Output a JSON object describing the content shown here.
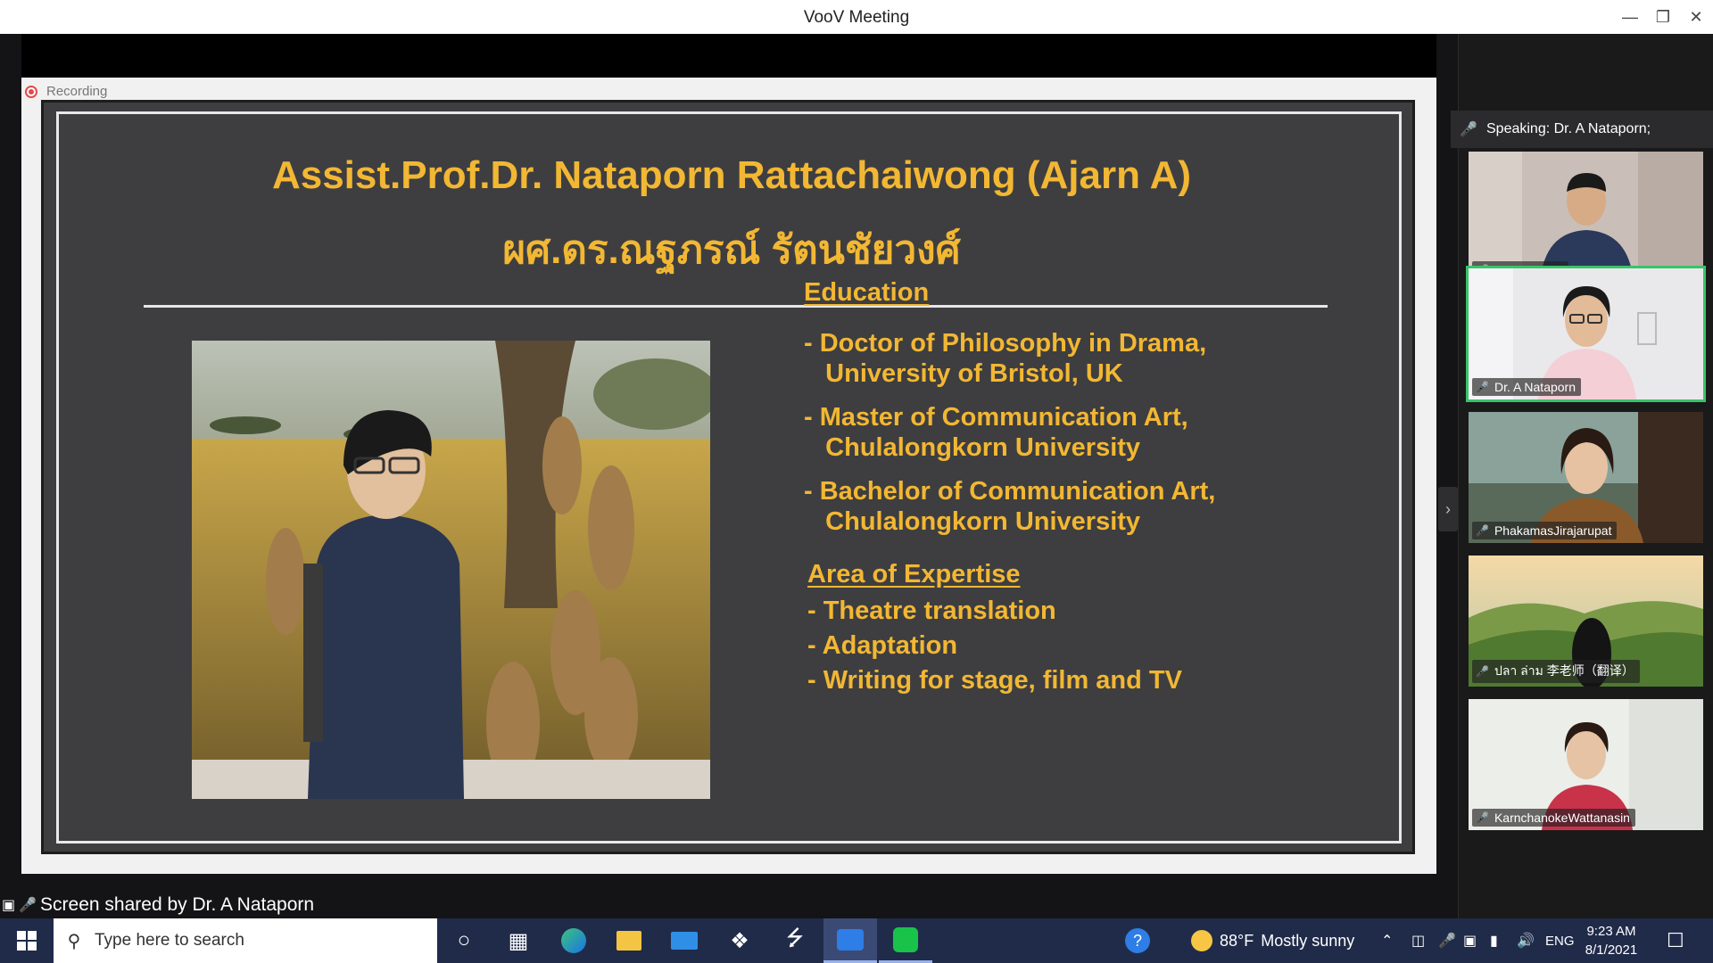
{
  "window": {
    "title": "VooV Meeting"
  },
  "recording": {
    "label": "Recording"
  },
  "slide": {
    "title_en": "Assist.Prof.Dr. Nataporn Rattachaiwong (Ajarn A)",
    "title_th": "ผศ.ดร.ณฐภรณ์ รัตนชัยวงศ์",
    "education_heading": "Education",
    "education": [
      "- Doctor of Philosophy in Drama,\n   University of Bristol, UK",
      "- Master of Communication Art,\n   Chulalongkorn University",
      "- Bachelor of Communication Art,\n   Chulalongkorn University"
    ],
    "expertise_heading": "Area of Expertise",
    "expertise": [
      "- Theatre translation",
      "- Adaptation",
      "- Writing for stage, film and TV"
    ]
  },
  "share_bar": {
    "text": "Screen shared by Dr. A Nataporn"
  },
  "panel": {
    "speaking": "Speaking: Dr. A Nataporn;",
    "participants": [
      {
        "name": "dejun huang",
        "active": false
      },
      {
        "name": "Dr. A Nataporn",
        "active": true
      },
      {
        "name": "PhakamasJirajarupat",
        "active": false
      },
      {
        "name": "ปลา ล่าม 李老师（翻译）",
        "active": false
      },
      {
        "name": "KarnchanokeWattanasin",
        "active": false
      }
    ]
  },
  "taskbar": {
    "search_placeholder": "Type here to search",
    "weather_temp": "88°F",
    "weather_text": "Mostly sunny",
    "language": "ENG",
    "time": "9:23 AM",
    "date": "8/1/2021"
  },
  "colors": {
    "slide_bg": "#3e3e40",
    "accent": "#f2b733",
    "active_speaker": "#38c46a",
    "taskbar": "#202b4a"
  }
}
